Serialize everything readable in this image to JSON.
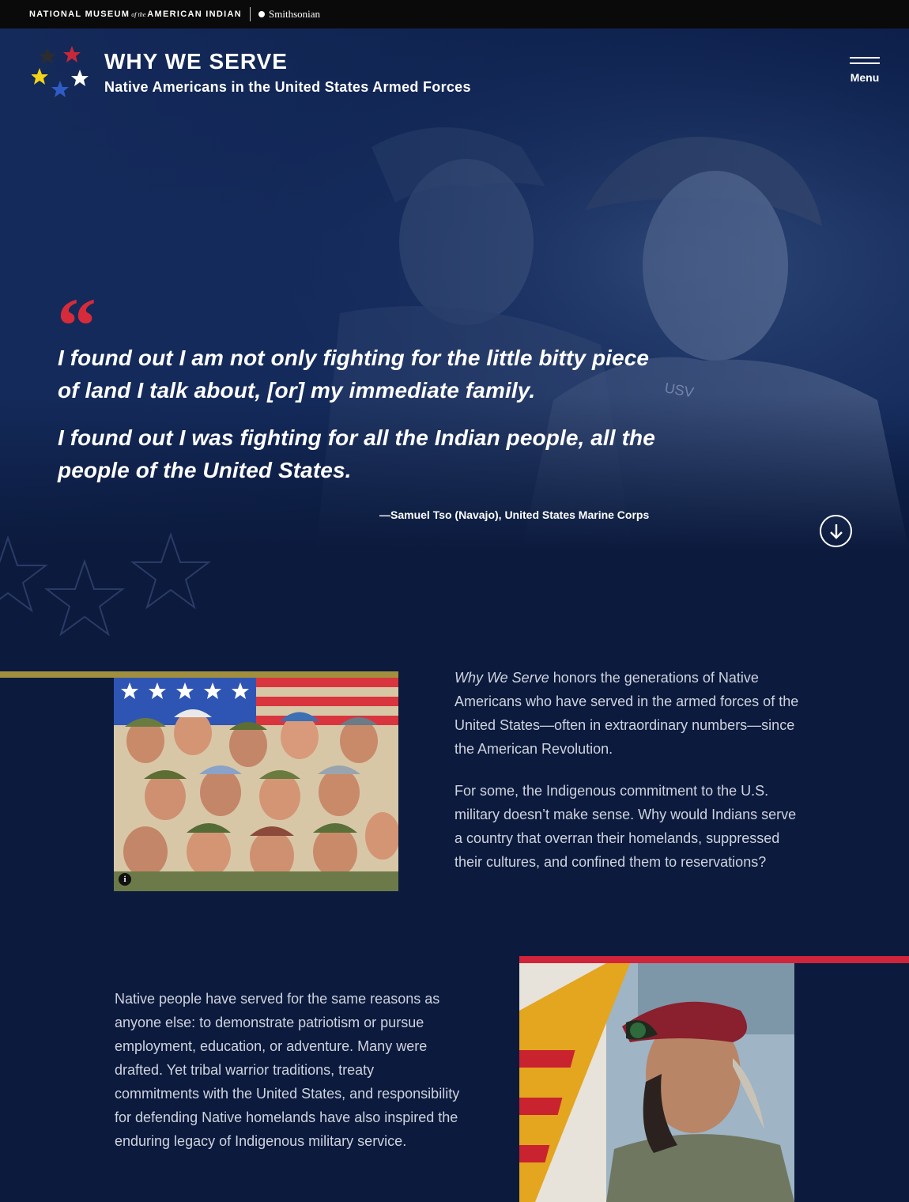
{
  "topbar": {
    "museum_part1": "NATIONAL MUSEUM",
    "museum_of": "of the",
    "museum_part2": "AMERICAN INDIAN",
    "smithsonian": "Smithsonian"
  },
  "header": {
    "title": "WHY WE SERVE",
    "subtitle": "Native Americans in the United States Armed Forces",
    "menu_label": "Menu",
    "star_colors": [
      "#2d2d2d",
      "#c7283a",
      "#f2d418",
      "#ffffff",
      "#2f5bc4"
    ]
  },
  "hero": {
    "quote_mark": "“",
    "quote_paragraphs": [
      "I found out I am not only fighting for the little bitty piece of land I talk about, [or] my immediate family.",
      "I found out I was fighting for all the Indian people, all the people of the United States."
    ],
    "attribution": "—Samuel Tso (Navajo), United States Marine Corps",
    "scroll_icon": "arrow-down-icon",
    "accent_color": "#d52b3a"
  },
  "intro": {
    "title_italic": "Why We Serve",
    "p1_rest": " honors the generations of Native Americans who have served in the armed forces of the United States—often in extraordinary numbers—since the American Revolution.",
    "p2": "For some, the Indigenous commitment to the U.S. military doesn’t make sense. Why would Indians serve a country that overran their homelands, suppressed their cultures, and confined them to reservations?",
    "info_label": "i",
    "gold_color": "#a28f3d"
  },
  "reasons": {
    "p1": "Native people have served for the same reasons as anyone else: to demonstrate patriotism or pursue employment, education, or adventure. Many were drafted. Yet tribal warrior traditions, treaty commitments with the United States, and responsibility for defending Native homelands have also inspired the enduring legacy of Indigenous military service.",
    "red_color": "#d0243a"
  }
}
